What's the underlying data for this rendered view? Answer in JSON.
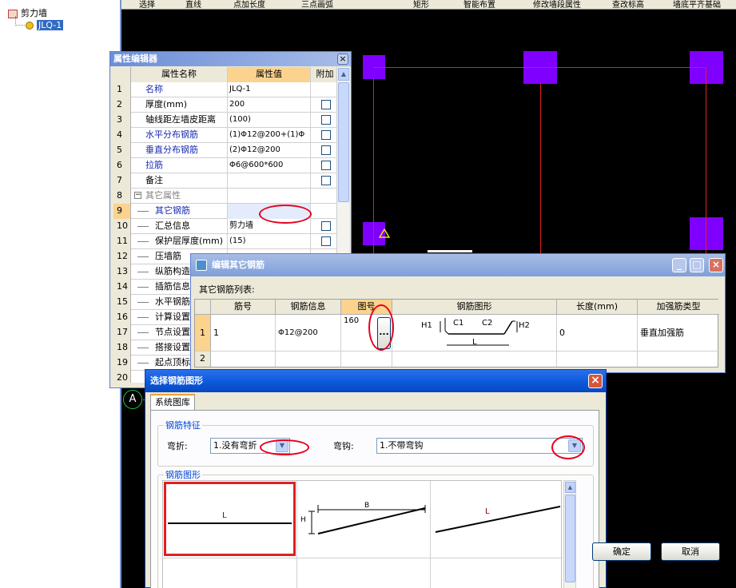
{
  "toolbar": {
    "items": [
      "选择",
      "直线",
      "点加长度",
      "三点画弧",
      "矩形",
      "智能布置",
      "修改墙段属性",
      "查改标高",
      "墙底平齐基础"
    ]
  },
  "tree": {
    "root": "剪力墙",
    "child": "JLQ-1"
  },
  "prop_editor": {
    "title": "属性编辑器",
    "headers": [
      "属性名称",
      "属性值",
      "附加"
    ],
    "rows": [
      {
        "num": "1",
        "name": "名称",
        "value": "JLQ-1",
        "check": false
      },
      {
        "num": "2",
        "name": "厚度(mm)",
        "value": "200",
        "check": true
      },
      {
        "num": "3",
        "name": "轴线距左墙皮距离",
        "value": "(100)",
        "check": true
      },
      {
        "num": "4",
        "name": "水平分布钢筋",
        "value": "(1)Φ12@200+(1)Φ",
        "check": true
      },
      {
        "num": "5",
        "name": "垂直分布钢筋",
        "value": "(2)Φ12@200",
        "check": true
      },
      {
        "num": "6",
        "name": "拉筋",
        "value": "Φ6@600*600",
        "check": true
      },
      {
        "num": "7",
        "name": "备注",
        "value": "",
        "check": true
      },
      {
        "num": "8",
        "name": "其它属性",
        "value": "",
        "check": false
      },
      {
        "num": "9",
        "name": "其它钢筋",
        "value": "",
        "check": false
      },
      {
        "num": "10",
        "name": "汇总信息",
        "value": "剪力墙",
        "check": true
      },
      {
        "num": "11",
        "name": "保护层厚度(mm)",
        "value": "(15)",
        "check": true
      },
      {
        "num": "12",
        "name": "压墙筋",
        "value": "",
        "check": false
      },
      {
        "num": "13",
        "name": "纵筋构造",
        "value": "",
        "check": false
      },
      {
        "num": "14",
        "name": "插筋信息",
        "value": "",
        "check": false
      },
      {
        "num": "15",
        "name": "水平钢筋",
        "value": "",
        "check": false
      },
      {
        "num": "16",
        "name": "计算设置",
        "value": "",
        "check": false
      },
      {
        "num": "17",
        "name": "节点设置",
        "value": "",
        "check": false
      },
      {
        "num": "18",
        "name": "搭接设置",
        "value": "",
        "check": false
      },
      {
        "num": "19",
        "name": "起点顶标",
        "value": "",
        "check": false
      },
      {
        "num": "20",
        "name": "",
        "value": "",
        "check": false
      }
    ],
    "collapse_symbol": "−"
  },
  "other_rebar": {
    "title": "编辑其它钢筋",
    "list_label": "其它钢筋列表:",
    "headers": [
      "筋号",
      "钢筋信息",
      "图号",
      "钢筋图形",
      "长度(mm)",
      "加强筋类型"
    ],
    "rows": [
      {
        "num": "1",
        "bar_no": "1",
        "info": "Φ12@200",
        "fig_no": "160",
        "ellipsis": "...",
        "length": "0",
        "type": "垂直加强筋",
        "shape": {
          "h1": "H1",
          "c1": "C1",
          "c2": "C2",
          "h2": "H2",
          "l": "L"
        }
      },
      {
        "num": "2",
        "bar_no": "",
        "info": "",
        "fig_no": "",
        "ellipsis": "",
        "length": "",
        "type": "",
        "shape": null
      }
    ]
  },
  "select_shape": {
    "title": "选择钢筋图形",
    "tab": "系统图库",
    "feature_group": "钢筋特征",
    "bend_label": "弯折:",
    "bend_value": "1.没有弯折",
    "hook_label": "弯钩:",
    "hook_value": "1.不带弯钩",
    "shape_group": "钢筋图形",
    "shapes": [
      {
        "label": "L",
        "selected": true
      },
      {
        "label_b": "B",
        "label_h": "H",
        "selected": false
      },
      {
        "label": "L",
        "selected": false
      }
    ],
    "ok": "确定",
    "cancel": "取消"
  },
  "canvas": {
    "axis_label": "A"
  },
  "colors": {
    "canvas_bg": "#000000",
    "column": "#7f00ff",
    "wall_line": "#e02020",
    "title_blue": "#0a57d8",
    "highlight": "#e8001c",
    "header_orange": "#fbd38e"
  }
}
